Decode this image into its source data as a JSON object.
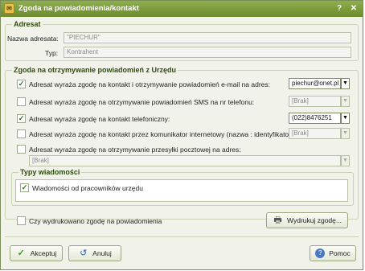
{
  "window": {
    "title": "Zgoda na powiadomienia/kontakt",
    "help_symbol": "?",
    "close_symbol": "✕"
  },
  "adresat": {
    "group_title": "Adresat",
    "name_label": "Nazwa adresata:",
    "name_value": "\"PIECHUR\"",
    "type_label": "Typ:",
    "type_value": "Kontrahent"
  },
  "zgoda": {
    "group_title": "Zgoda na otrzymywanie powiadomień z Urzędu",
    "rows": [
      {
        "label": "Adresat wyraża zgodę na kontakt i otrzymywanie powiadomień e-mail na adres:",
        "checked": true,
        "value": "piechur@onet.pl",
        "active": true
      },
      {
        "label": "Adresat wyraża zgodę na otrzymywanie powiadomień SMS na nr telefonu:",
        "checked": false,
        "value": "[Brak]",
        "active": false
      },
      {
        "label": "Adresat wyraża zgodę na kontakt telefoniczny:",
        "checked": true,
        "value": "(022)8476251",
        "active": true
      },
      {
        "label": "Adresat wyraża zgodę na kontakt przez komunikator internetowy (nazwa : identyfikator):",
        "checked": false,
        "value": "[Brak]",
        "active": false
      },
      {
        "label": "Adresat wyraża zgodę na otrzymywanie przesyłki pocztowej na adres:",
        "checked": false,
        "value": "[Brak]",
        "active": false
      }
    ]
  },
  "typy": {
    "group_title": "Typy wiadomości",
    "items": [
      {
        "label": "Wiadomości od pracowników urzędu",
        "checked": true
      }
    ]
  },
  "print": {
    "checkbox_label": "Czy wydrukowano zgodę na powiadomienia",
    "checked": false,
    "button_label": "Wydrukuj zgodę..."
  },
  "buttons": {
    "accept": "Akceptuj",
    "cancel": "Anuluj",
    "help": "Pomoc"
  },
  "symbols": {
    "check": "✓",
    "arrow": "▼"
  },
  "colors": {
    "titlebar": "#7a9a3c",
    "group_title": "#2e4b0e",
    "accept_icon": "#3a9a1a"
  }
}
